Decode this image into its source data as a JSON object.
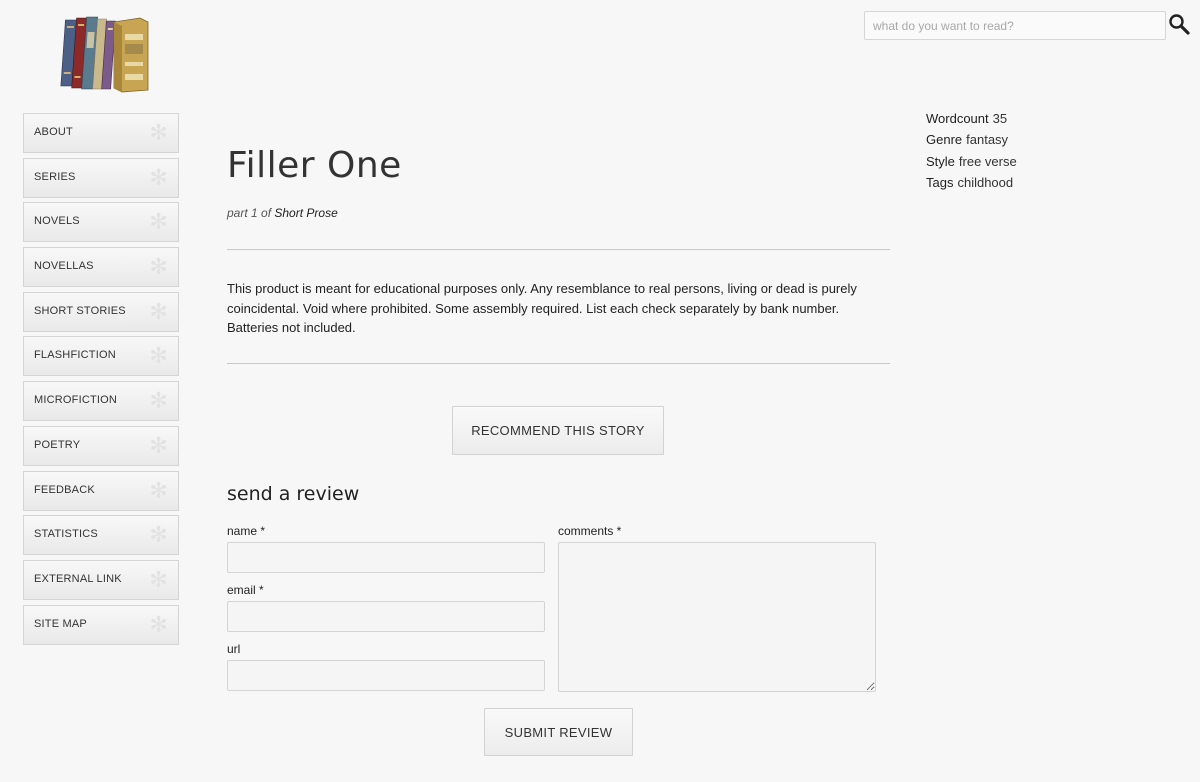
{
  "search": {
    "placeholder": "what do you want to read?"
  },
  "nav": [
    "ABOUT",
    "SERIES",
    "NOVELS",
    "NOVELLAS",
    "SHORT STORIES",
    "FLASHFICTION",
    "MICROFICTION",
    "POETRY",
    "FEEDBACK",
    "STATISTICS",
    "EXTERNAL LINK",
    "SITE MAP"
  ],
  "story": {
    "title": "Filler One",
    "part_prefix": "part 1 of ",
    "series": "Short Prose",
    "body": "This product is meant for educational purposes only. Any resemblance to real persons, living or dead is purely coincidental. Void where prohibited. Some assembly required. List each check separately by bank number. Batteries not included.",
    "recommend_label": "RECOMMEND THIS STORY"
  },
  "meta": {
    "wordcount_label": "Wordcount",
    "wordcount": "35",
    "genre_label": "Genre",
    "genre": "fantasy",
    "style_label": "Style",
    "style": "free verse",
    "tags_label": "Tags",
    "tags": "childhood"
  },
  "review": {
    "heading": "send a review",
    "name_label": "name *",
    "email_label": "email *",
    "url_label": "url",
    "comments_label": "comments *",
    "submit_label": "SUBMIT REVIEW"
  },
  "colors": {
    "background": "#f7f7f7",
    "rule": "#c8c8c8",
    "button_border": "#d2d2d2"
  },
  "icons": {
    "logo": "books-logo",
    "search": "magnifier-icon",
    "nav_star": "asterisk-icon"
  }
}
